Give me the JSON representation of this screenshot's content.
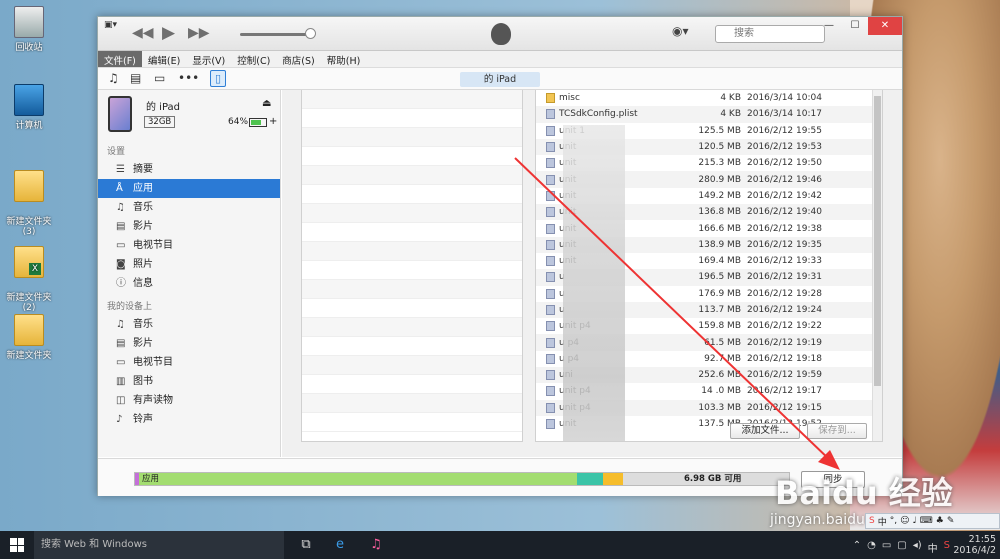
{
  "desktop": {
    "icons": [
      {
        "label": "回收站"
      },
      {
        "label": "计算机"
      },
      {
        "label": "新建文件夹\n(3)"
      },
      {
        "label": "新建文件夹\n(2)"
      },
      {
        "label": "新建文件夹"
      }
    ]
  },
  "titlebar": {
    "search_placeholder": "搜索"
  },
  "menubar": {
    "items": [
      "文件(F)",
      "编辑(E)",
      "显示(V)",
      "控制(C)",
      "商店(S)",
      "帮助(H)"
    ]
  },
  "toolbar": {
    "device_tab": "的 iPad"
  },
  "device": {
    "name": "的 iPad",
    "capacity": "32GB",
    "battery": "64%"
  },
  "sidebar": {
    "settings_header": "设置",
    "settings_items": [
      "摘要",
      "应用",
      "音乐",
      "影片",
      "电视节目",
      "照片",
      "信息"
    ],
    "selected": "应用",
    "ondevice_header": "我的设备上",
    "ondevice_items": [
      "音乐",
      "影片",
      "电视节目",
      "图书",
      "有声读物",
      "铃声"
    ]
  },
  "files": [
    {
      "name": "misc",
      "size": "4 KB",
      "date": "2016/3/14 10:04",
      "folder": true
    },
    {
      "name": "TCSdkConfig.plist",
      "size": "4 KB",
      "date": "2016/3/14 10:17",
      "folder": false
    },
    {
      "name": "unit 1",
      "size": "125.5 MB",
      "date": "2016/2/12 19:55",
      "folder": false
    },
    {
      "name": "unit",
      "size": "120.5 MB",
      "date": "2016/2/12 19:53",
      "folder": false
    },
    {
      "name": "unit",
      "size": "215.3 MB",
      "date": "2016/2/12 19:50",
      "folder": false
    },
    {
      "name": "unit",
      "size": "280.9 MB",
      "date": "2016/2/12 19:46",
      "folder": false
    },
    {
      "name": "unit",
      "size": "149.2 MB",
      "date": "2016/2/12 19:42",
      "folder": false
    },
    {
      "name": "unit",
      "size": "136.8 MB",
      "date": "2016/2/12 19:40",
      "folder": false
    },
    {
      "name": "unit",
      "size": "166.6 MB",
      "date": "2016/2/12 19:38",
      "folder": false
    },
    {
      "name": "unit",
      "size": "138.9 MB",
      "date": "2016/2/12 19:35",
      "folder": false
    },
    {
      "name": "unit",
      "size": "169.4 MB",
      "date": "2016/2/12 19:33",
      "folder": false
    },
    {
      "name": "u",
      "size": "196.5 MB",
      "date": "2016/2/12 19:31",
      "folder": false
    },
    {
      "name": "u",
      "size": "176.9 MB",
      "date": "2016/2/12 19:28",
      "folder": false
    },
    {
      "name": "u",
      "size": "113.7 MB",
      "date": "2016/2/12 19:24",
      "folder": false
    },
    {
      "name": "unit  p4",
      "size": "159.8 MB",
      "date": "2016/2/12 19:22",
      "folder": false
    },
    {
      "name": "u  p4",
      "size": "61.5 MB",
      "date": "2016/2/12 19:19",
      "folder": false
    },
    {
      "name": "u  p4",
      "size": "92.7 MB",
      "date": "2016/2/12 19:18",
      "folder": false
    },
    {
      "name": "uni",
      "size": "252.6 MB",
      "date": "2016/2/12 19:59",
      "folder": false
    },
    {
      "name": "unit  p4",
      "size": "14 .0 MB",
      "date": "2016/2/12 19:17",
      "folder": false
    },
    {
      "name": "unit  p4",
      "size": "103.3 MB",
      "date": "2016/2/12 19:15",
      "folder": false
    },
    {
      "name": "unit",
      "size": "137.5 MB",
      "date": "2016/2/12 19:52",
      "folder": false
    }
  ],
  "buttons": {
    "add_file": "添加文件...",
    "save_to": "保存到...",
    "sync": "同步"
  },
  "storage": {
    "apps_label": "应用",
    "free_label": "6.98 GB 可用",
    "segments": [
      {
        "color": "#c46fd8",
        "fraction": 0.006
      },
      {
        "color": "#a3dd70",
        "fraction": 0.67
      },
      {
        "color": "#3bc4a7",
        "fraction": 0.04
      },
      {
        "color": "#f6bd2b",
        "fraction": 0.03
      }
    ]
  },
  "watermark": {
    "brand": "Baidu 经验",
    "url": "jingyan.baidu"
  },
  "taskbar": {
    "search": "搜索 Web 和 Windows",
    "time": "21:55",
    "date": "2016/4/2",
    "ime": "中"
  }
}
